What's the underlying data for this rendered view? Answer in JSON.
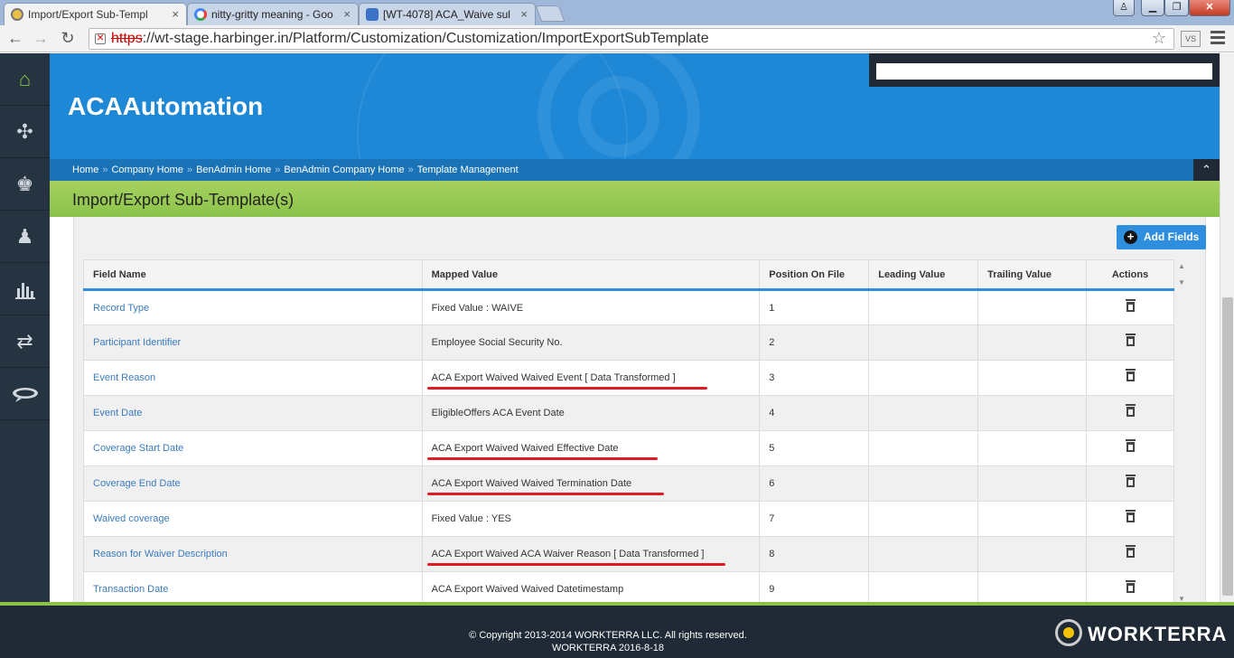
{
  "browser": {
    "tabs": [
      {
        "title": "Import/Export Sub-Templ",
        "favicon": "harbinger-icon"
      },
      {
        "title": "nitty-gritty meaning - Goo",
        "favicon": "google-icon"
      },
      {
        "title": "[WT-4078] ACA_Waive sul",
        "favicon": "jira-icon"
      }
    ],
    "url_scheme": "https",
    "url_rest": "://wt-stage.harbinger.in/Platform/Customization/Customization/ImportExportSubTemplate",
    "extension_label": "VS"
  },
  "sidebar": {
    "items": [
      {
        "icon": "home-icon",
        "glyph": "⌂"
      },
      {
        "icon": "puzzle-icon",
        "glyph": "✣"
      },
      {
        "icon": "user-star-icon",
        "glyph": "♚"
      },
      {
        "icon": "user-icon",
        "glyph": "♟"
      },
      {
        "icon": "bar-chart-icon",
        "glyph": "▮"
      },
      {
        "icon": "transfer-arrows-icon",
        "glyph": "⇄"
      },
      {
        "icon": "chat-icon",
        "glyph": "💬"
      }
    ]
  },
  "header": {
    "brand": "ACAAutomation"
  },
  "breadcrumb": [
    "Home",
    "Company Home",
    "BenAdmin Home",
    "BenAdmin Company Home",
    "Template Management"
  ],
  "breadcrumb_separator": "»",
  "page_title": "Import/Export Sub-Template(s)",
  "toolbar": {
    "add_fields_label": "Add Fields"
  },
  "table": {
    "columns": [
      "Field Name",
      "Mapped Value",
      "Position On File",
      "Leading Value",
      "Trailing Value",
      "Actions"
    ],
    "rows": [
      {
        "field": "Record Type",
        "mapped": "Fixed Value : WAIVE",
        "position": "1",
        "leading": "",
        "trailing": "",
        "highlighted": false
      },
      {
        "field": "Participant Identifier",
        "mapped": "Employee Social Security No.",
        "position": "2",
        "leading": "",
        "trailing": "",
        "highlighted": false
      },
      {
        "field": "Event Reason",
        "mapped": "ACA Export Waived Waived Event [ Data Transformed ]",
        "position": "3",
        "leading": "",
        "trailing": "",
        "highlighted": true
      },
      {
        "field": "Event Date",
        "mapped": "EligibleOffers ACA Event Date",
        "position": "4",
        "leading": "",
        "trailing": "",
        "highlighted": false
      },
      {
        "field": "Coverage Start Date",
        "mapped": "ACA Export Waived Waived Effective Date",
        "position": "5",
        "leading": "",
        "trailing": "",
        "highlighted": true
      },
      {
        "field": "Coverage End Date",
        "mapped": "ACA Export Waived Waived Termination Date",
        "position": "6",
        "leading": "",
        "trailing": "",
        "highlighted": true
      },
      {
        "field": "Waived coverage",
        "mapped": "Fixed Value : YES",
        "position": "7",
        "leading": "",
        "trailing": "",
        "highlighted": false
      },
      {
        "field": "Reason for Waiver Description",
        "mapped": "ACA Export Waived ACA Waiver Reason [ Data Transformed ]",
        "position": "8",
        "leading": "",
        "trailing": "",
        "highlighted": true
      },
      {
        "field": "Transaction Date",
        "mapped": "ACA Export Waived Waived Datetimestamp",
        "position": "9",
        "leading": "",
        "trailing": "",
        "highlighted": false
      }
    ]
  },
  "footer": {
    "copyright": "© Copyright 2013-2014 WORKTERRA LLC. All rights reserved.",
    "version": "WORKTERRA 2016-8-18",
    "brand": "WORKTERRA"
  },
  "colors": {
    "sidebar": "#263340",
    "banner": "#1e88d6",
    "title_bar": "#8bc34a",
    "accent": "#2f8fde",
    "annotation_red": "#e01b24"
  }
}
